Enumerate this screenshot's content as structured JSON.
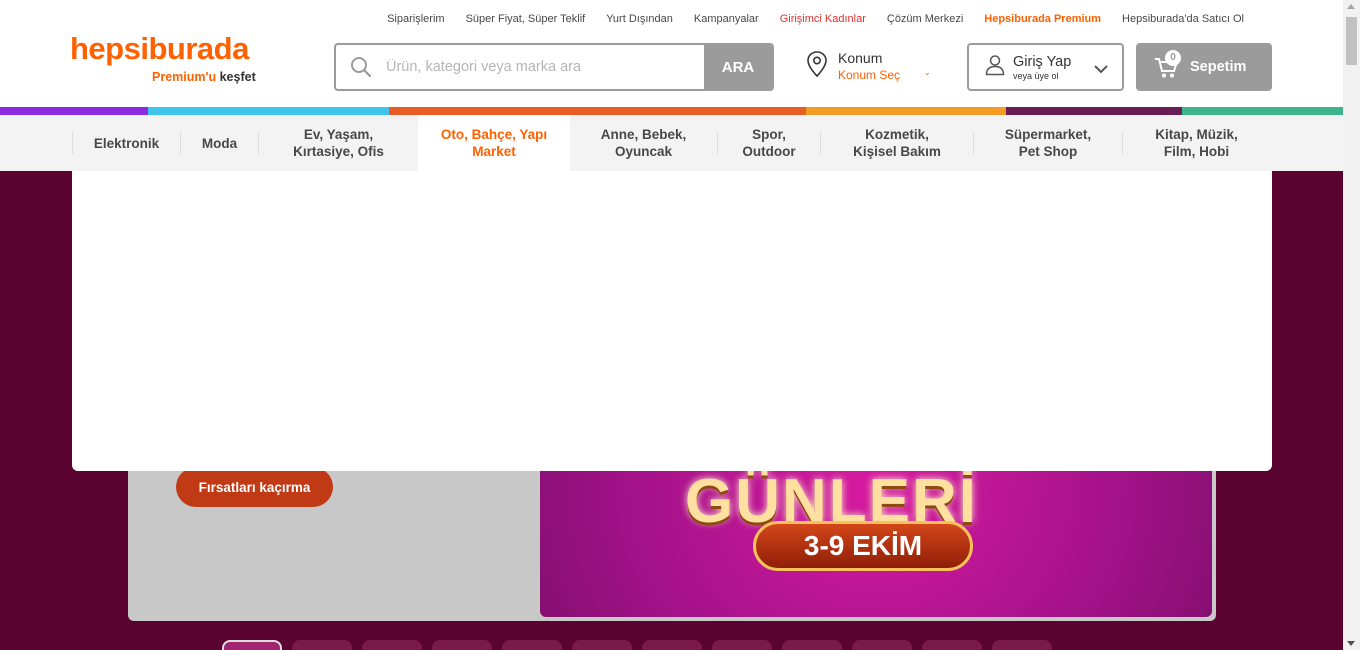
{
  "top_links": [
    {
      "label": "Siparişlerim",
      "color": "#484848"
    },
    {
      "label": "Süper Fiyat, Süper Teklif",
      "color": "#484848"
    },
    {
      "label": "Yurt Dışından",
      "color": "#484848"
    },
    {
      "label": "Kampanyalar",
      "color": "#484848"
    },
    {
      "label": "Girişimci Kadınlar",
      "color": "#e2322d"
    },
    {
      "label": "Çözüm Merkezi",
      "color": "#484848"
    },
    {
      "label": "Hepsiburada Premium",
      "color": "#ff6000"
    },
    {
      "label": "Hepsiburada'da Satıcı Ol",
      "color": "#484848"
    }
  ],
  "logo": {
    "name": "hepsiburada",
    "premium": "Premium'u",
    "discover": "keşfet",
    "color": "#ff6000"
  },
  "search": {
    "placeholder": "Ürün, kategori veya marka ara",
    "button": "ARA"
  },
  "location": {
    "title": "Konum",
    "action": "Konum Seç"
  },
  "login": {
    "title": "Giriş Yap",
    "subtitle": "veya üye ol"
  },
  "cart": {
    "count": "0",
    "label": "Sepetim"
  },
  "color_strip": [
    "#8a2be2",
    "#3fc5ec",
    "#ea5c26",
    "#f29b25",
    "#6b1c55",
    "#3fb48a"
  ],
  "categories": [
    {
      "label": "Elektronik",
      "active": false
    },
    {
      "label": "Moda",
      "active": false
    },
    {
      "label": "Ev, Yaşam,\nKırtasiye, Ofis",
      "active": false
    },
    {
      "label": "Oto, Bahçe, Yapı\nMarket",
      "active": true
    },
    {
      "label": "Anne, Bebek,\nOyuncak",
      "active": false
    },
    {
      "label": "Spor,\nOutdoor",
      "active": false
    },
    {
      "label": "Kozmetik,\nKişisel Bakım",
      "active": false
    },
    {
      "label": "Süpermarket,\nPet Shop",
      "active": false
    },
    {
      "label": "Kitap, Müzik,\nFilm, Hobi",
      "active": false
    }
  ],
  "promo": {
    "cta": "Fırsatları kaçırma",
    "headline": "GÜNLERİ",
    "dates": "3-9 EKİM"
  }
}
